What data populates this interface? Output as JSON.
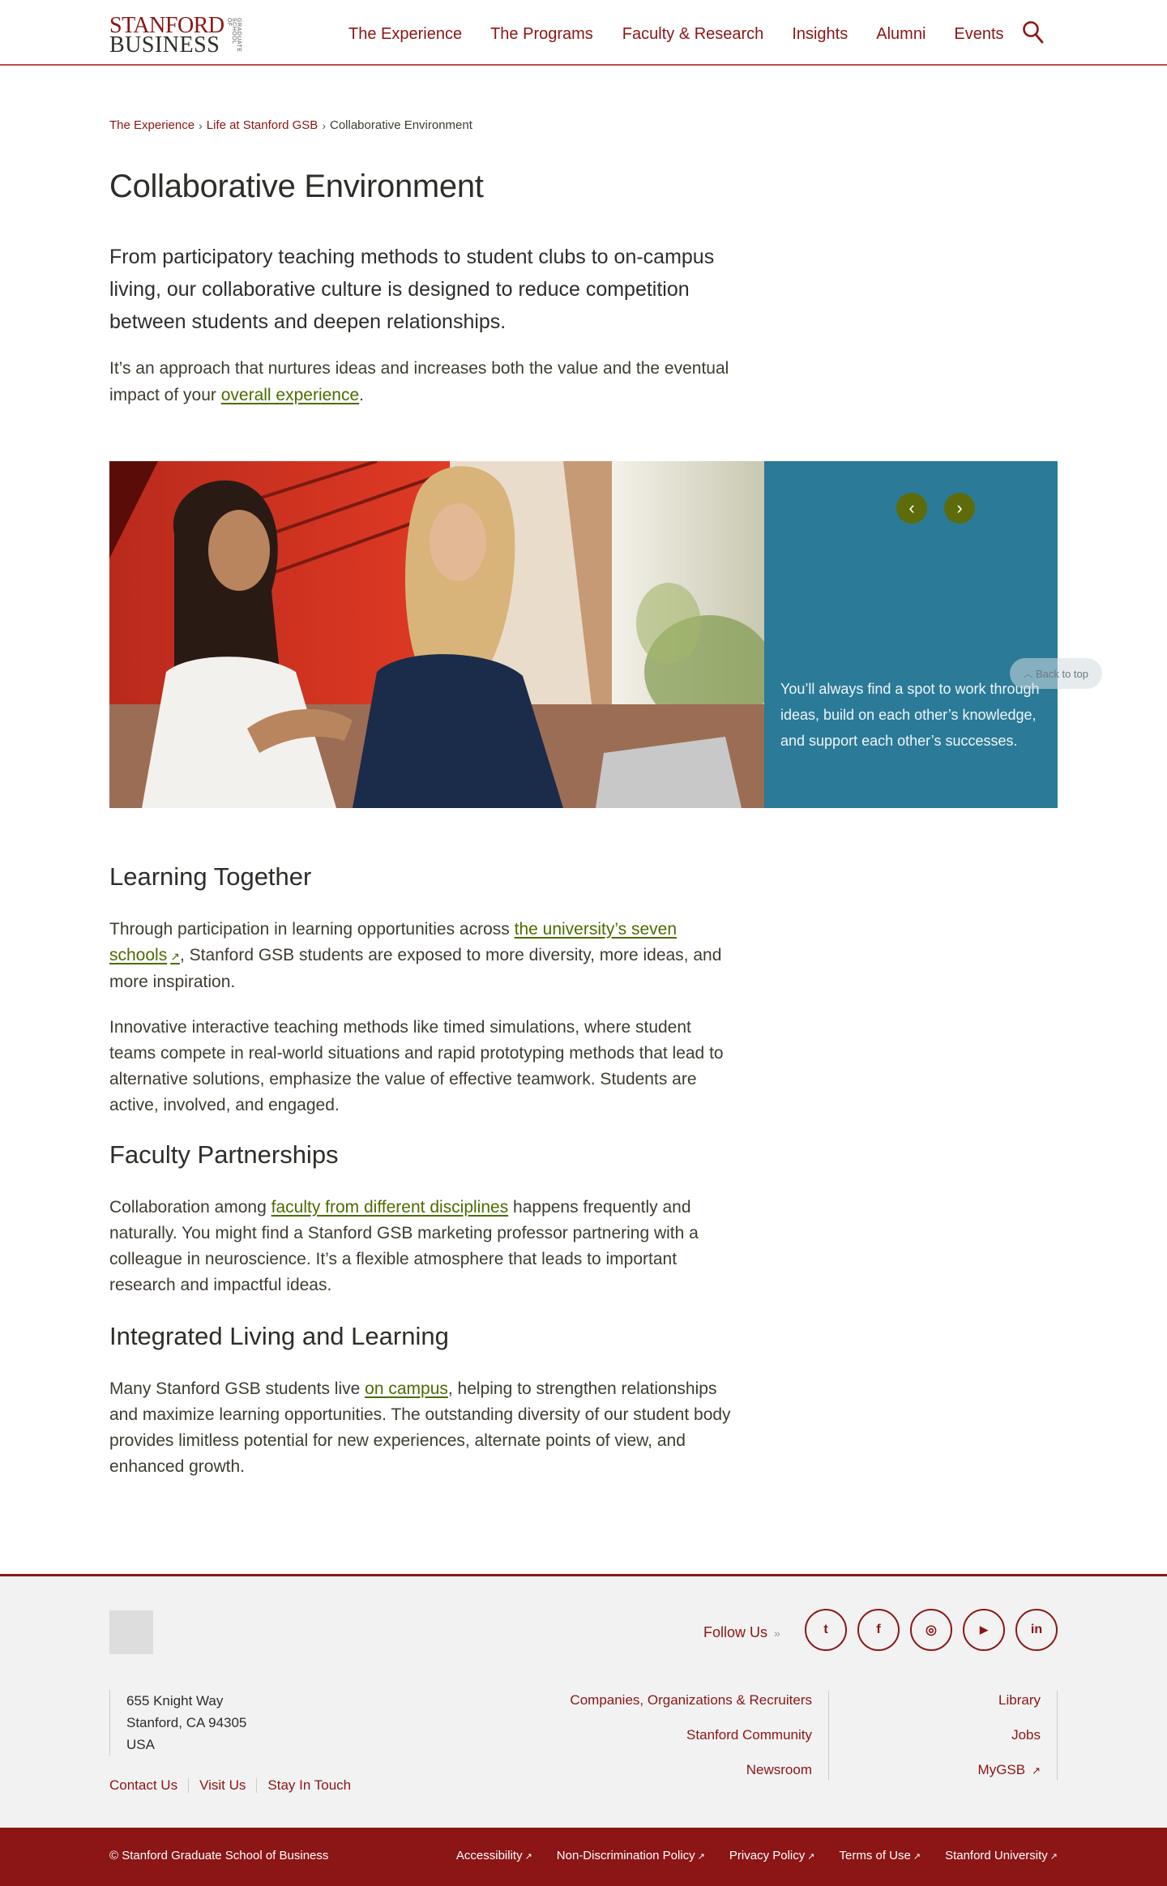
{
  "header": {
    "logo_line1": "STANFORD",
    "logo_line2": "BUSINESS",
    "logo_side": "GRADUATE SCHOOL OF",
    "nav": [
      "The Experience",
      "The Programs",
      "Faculty & Research",
      "Insights",
      "Alumni",
      "Events"
    ],
    "search_icon": "search-icon"
  },
  "breadcrumb": {
    "items": [
      "The Experience",
      "Life at Stanford GSB"
    ],
    "separator": "›",
    "current": "Collaborative Environment"
  },
  "page": {
    "title": "Collaborative Environment",
    "lead": "From participatory teaching methods to student clubs to on-campus living, our collaborative culture is designed to reduce competition between students and deepen relationships.",
    "intro_before": "It’s an approach that nurtures ideas and increases both the value and the eventual impact of your ",
    "intro_link": "overall experience",
    "intro_after": "."
  },
  "carousel": {
    "prev_icon": "chevron-left-icon",
    "next_icon": "chevron-right-icon",
    "prev_glyph": "‹",
    "next_glyph": "›",
    "caption": "You’ll always find a spot to work through ideas, build on each other’s knowledge, and support each other’s successes.",
    "back_to_top": "Back to top",
    "panel_color": "#2b7a97",
    "button_color": "#5d6b0a"
  },
  "sections": {
    "learning": {
      "heading": "Learning Together",
      "p1_before": "Through participation in learning opportunities across ",
      "p1_link": "the university’s seven schools",
      "p1_after": ", Stanford GSB students are exposed to more diversity, more ideas, and more inspiration.",
      "p2": "Innovative interactive teaching methods like timed simulations, where student teams compete in real-world situations and rapid prototyping methods that lead to alternative solutions, emphasize the value of effective teamwork. Students are active, involved, and engaged."
    },
    "faculty": {
      "heading": "Faculty Partnerships",
      "p1_before": "Collaboration among ",
      "p1_link": "faculty from different disciplines",
      "p1_after": " happens frequently and naturally. You might find a Stanford GSB marketing professor partnering with a colleague in neuroscience. It’s a flexible atmosphere that leads to important research and impactful ideas."
    },
    "living": {
      "heading": "Integrated Living and Learning",
      "p1_before": "Many Stanford GSB students live ",
      "p1_link": "on campus",
      "p1_after": ", helping to strengthen relationships and maximize learning opportunities. The outstanding diversity of our student body provides limitless potential for new experiences, alternate points of view, and enhanced growth."
    }
  },
  "footer": {
    "follow_label": "Follow Us",
    "social": [
      {
        "name": "twitter-icon",
        "glyph": "t"
      },
      {
        "name": "facebook-icon",
        "glyph": "f"
      },
      {
        "name": "instagram-icon",
        "glyph": "◎"
      },
      {
        "name": "youtube-icon",
        "glyph": "▶"
      },
      {
        "name": "linkedin-icon",
        "glyph": "in"
      }
    ],
    "address": [
      "655 Knight Way",
      "Stanford, CA 94305",
      "USA"
    ],
    "left_links": [
      "Contact Us",
      "Visit Us",
      "Stay In Touch"
    ],
    "mid_links": [
      "Companies, Organizations & Recruiters",
      "Stanford Community",
      "Newsroom"
    ],
    "right_links": [
      "Library",
      "Jobs",
      "MyGSB"
    ],
    "copyright": "© Stanford Graduate School of Business",
    "bottom_links": [
      "Accessibility",
      "Non-Discrimination Policy",
      "Privacy Policy",
      "Terms of Use",
      "Stanford University"
    ],
    "brand_color": "#8c1515"
  }
}
